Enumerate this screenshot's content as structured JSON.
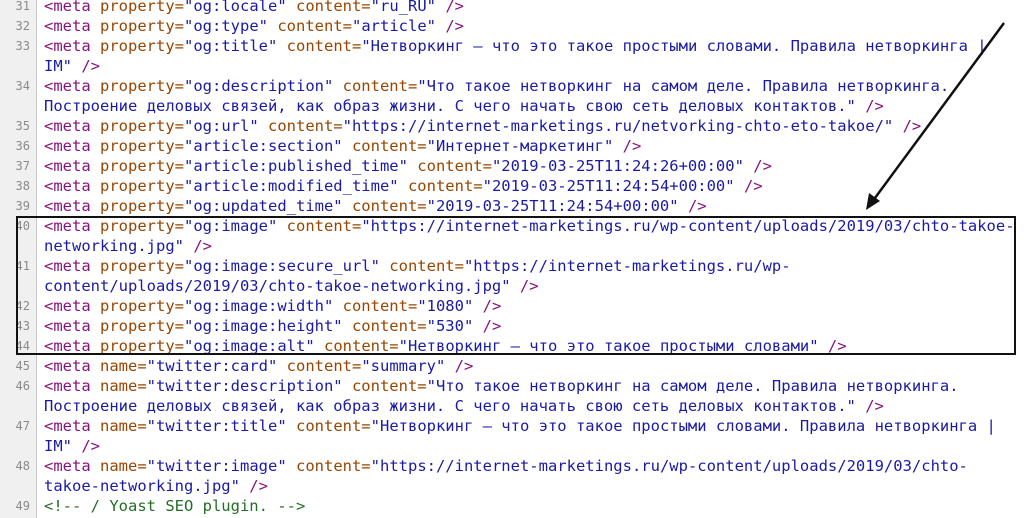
{
  "source_view": {
    "rows": [
      {
        "n": "31",
        "s": [
          [
            "tag",
            "<meta "
          ],
          [
            "attr",
            "property="
          ],
          [
            "val",
            "\"og:locale\""
          ],
          [
            "attr",
            " content="
          ],
          [
            "val",
            "\"ru_RU\""
          ],
          [
            "tag",
            " />"
          ]
        ]
      },
      {
        "n": "32",
        "s": [
          [
            "tag",
            "<meta "
          ],
          [
            "attr",
            "property="
          ],
          [
            "val",
            "\"og:type\""
          ],
          [
            "attr",
            " content="
          ],
          [
            "val",
            "\"article\""
          ],
          [
            "tag",
            " />"
          ]
        ]
      },
      {
        "n": "33",
        "s": [
          [
            "tag",
            "<meta "
          ],
          [
            "attr",
            "property="
          ],
          [
            "val",
            "\"og:title\""
          ],
          [
            "attr",
            " content="
          ],
          [
            "val",
            "\"Нетворкинг – что это такое простыми словами. Правила нетворкинга |"
          ]
        ]
      },
      {
        "n": "",
        "s": [
          [
            "val",
            "IM\""
          ],
          [
            "tag",
            " />"
          ]
        ]
      },
      {
        "n": "34",
        "s": [
          [
            "tag",
            "<meta "
          ],
          [
            "attr",
            "property="
          ],
          [
            "val",
            "\"og:description\""
          ],
          [
            "attr",
            " content="
          ],
          [
            "val",
            "\"Что такое нетворкинг на самом деле. Правила нетворкинга."
          ]
        ]
      },
      {
        "n": "",
        "s": [
          [
            "val",
            "Построение деловых связей, как образ жизни. С чего начать свою сеть деловых контактов.\""
          ],
          [
            "tag",
            " />"
          ]
        ]
      },
      {
        "n": "35",
        "s": [
          [
            "tag",
            "<meta "
          ],
          [
            "attr",
            "property="
          ],
          [
            "val",
            "\"og:url\""
          ],
          [
            "attr",
            " content="
          ],
          [
            "val",
            "\"https://internet-marketings.ru/netvorking-chto-eto-takoe/\""
          ],
          [
            "tag",
            " />"
          ]
        ]
      },
      {
        "n": "36",
        "s": [
          [
            "tag",
            "<meta "
          ],
          [
            "attr",
            "property="
          ],
          [
            "val",
            "\"article:section\""
          ],
          [
            "attr",
            " content="
          ],
          [
            "val",
            "\"Интернет-маркетинг\""
          ],
          [
            "tag",
            " />"
          ]
        ]
      },
      {
        "n": "37",
        "s": [
          [
            "tag",
            "<meta "
          ],
          [
            "attr",
            "property="
          ],
          [
            "val",
            "\"article:published_time\""
          ],
          [
            "attr",
            " content="
          ],
          [
            "val",
            "\"2019-03-25T11:24:26+00:00\""
          ],
          [
            "tag",
            " />"
          ]
        ]
      },
      {
        "n": "38",
        "s": [
          [
            "tag",
            "<meta "
          ],
          [
            "attr",
            "property="
          ],
          [
            "val",
            "\"article:modified_time\""
          ],
          [
            "attr",
            " content="
          ],
          [
            "val",
            "\"2019-03-25T11:24:54+00:00\""
          ],
          [
            "tag",
            " />"
          ]
        ]
      },
      {
        "n": "39",
        "s": [
          [
            "tag",
            "<meta "
          ],
          [
            "attr",
            "property="
          ],
          [
            "val",
            "\"og:updated_time\""
          ],
          [
            "attr",
            " content="
          ],
          [
            "val",
            "\"2019-03-25T11:24:54+00:00\""
          ],
          [
            "tag",
            " />"
          ]
        ]
      },
      {
        "n": "40",
        "s": [
          [
            "tag",
            "<meta "
          ],
          [
            "attr",
            "property="
          ],
          [
            "val",
            "\"og:image\""
          ],
          [
            "attr",
            " content="
          ],
          [
            "val",
            "\"https://internet-marketings.ru/wp-content/uploads/2019/03/chto-takoe-"
          ]
        ]
      },
      {
        "n": "",
        "s": [
          [
            "val",
            "networking.jpg\""
          ],
          [
            "tag",
            " />"
          ]
        ]
      },
      {
        "n": "41",
        "s": [
          [
            "tag",
            "<meta "
          ],
          [
            "attr",
            "property="
          ],
          [
            "val",
            "\"og:image:secure_url\""
          ],
          [
            "attr",
            " content="
          ],
          [
            "val",
            "\"https://internet-marketings.ru/wp-"
          ]
        ]
      },
      {
        "n": "",
        "s": [
          [
            "val",
            "content/uploads/2019/03/chto-takoe-networking.jpg\""
          ],
          [
            "tag",
            " />"
          ]
        ]
      },
      {
        "n": "42",
        "s": [
          [
            "tag",
            "<meta "
          ],
          [
            "attr",
            "property="
          ],
          [
            "val",
            "\"og:image:width\""
          ],
          [
            "attr",
            " content="
          ],
          [
            "val",
            "\"1080\""
          ],
          [
            "tag",
            " />"
          ]
        ]
      },
      {
        "n": "43",
        "s": [
          [
            "tag",
            "<meta "
          ],
          [
            "attr",
            "property="
          ],
          [
            "val",
            "\"og:image:height\""
          ],
          [
            "attr",
            " content="
          ],
          [
            "val",
            "\"530\""
          ],
          [
            "tag",
            " />"
          ]
        ]
      },
      {
        "n": "44",
        "s": [
          [
            "tag",
            "<meta "
          ],
          [
            "attr",
            "property="
          ],
          [
            "val",
            "\"og:image:alt\""
          ],
          [
            "attr",
            " content="
          ],
          [
            "val",
            "\"Нетворкинг – что это такое простыми словами\""
          ],
          [
            "tag",
            " />"
          ]
        ]
      },
      {
        "n": "45",
        "s": [
          [
            "tag",
            "<meta "
          ],
          [
            "attr",
            "name="
          ],
          [
            "val",
            "\"twitter:card\""
          ],
          [
            "attr",
            " content="
          ],
          [
            "val",
            "\"summary\""
          ],
          [
            "tag",
            " />"
          ]
        ]
      },
      {
        "n": "46",
        "s": [
          [
            "tag",
            "<meta "
          ],
          [
            "attr",
            "name="
          ],
          [
            "val",
            "\"twitter:description\""
          ],
          [
            "attr",
            " content="
          ],
          [
            "val",
            "\"Что такое нетворкинг на самом деле. Правила нетворкинга."
          ]
        ]
      },
      {
        "n": "",
        "s": [
          [
            "val",
            "Построение деловых связей, как образ жизни. С чего начать свою сеть деловых контактов.\""
          ],
          [
            "tag",
            " />"
          ]
        ]
      },
      {
        "n": "47",
        "s": [
          [
            "tag",
            "<meta "
          ],
          [
            "attr",
            "name="
          ],
          [
            "val",
            "\"twitter:title\""
          ],
          [
            "attr",
            " content="
          ],
          [
            "val",
            "\"Нетворкинг – что это такое простыми словами. Правила нетворкинга |"
          ]
        ]
      },
      {
        "n": "",
        "s": [
          [
            "val",
            "IM\""
          ],
          [
            "tag",
            " />"
          ]
        ]
      },
      {
        "n": "48",
        "s": [
          [
            "tag",
            "<meta "
          ],
          [
            "attr",
            "name="
          ],
          [
            "val",
            "\"twitter:image\""
          ],
          [
            "attr",
            " content="
          ],
          [
            "val",
            "\"https://internet-marketings.ru/wp-content/uploads/2019/03/chto-"
          ]
        ]
      },
      {
        "n": "",
        "s": [
          [
            "val",
            "takoe-networking.jpg\""
          ],
          [
            "tag",
            " />"
          ]
        ]
      },
      {
        "n": "49",
        "s": [
          [
            "com",
            "<!-- / Yoast SEO plugin. -->"
          ]
        ]
      }
    ]
  },
  "annotation": {
    "highlighted_lines": [
      "40",
      "41",
      "42",
      "43",
      "44"
    ],
    "box_color": "#111111",
    "arrow_color": "#111111"
  },
  "colors": {
    "tag": "#881280",
    "attribute": "#994500",
    "value": "#1a1aa6",
    "comment": "#236e25",
    "gutter": "#f0f0f0"
  }
}
